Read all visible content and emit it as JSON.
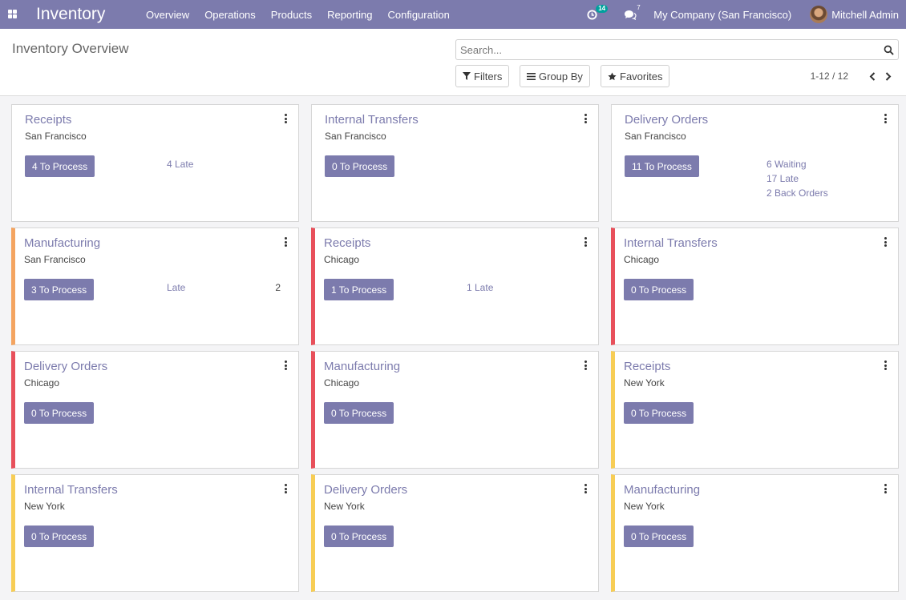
{
  "navbar": {
    "brand": "Inventory",
    "menu": [
      "Overview",
      "Operations",
      "Products",
      "Reporting",
      "Configuration"
    ],
    "activity_count": "14",
    "messages_count": "7",
    "company": "My Company (San Francisco)",
    "user": "Mitchell Admin",
    "colors": {
      "navbar": "#7c7bad",
      "badge": "#00a09d"
    }
  },
  "control_panel": {
    "title": "Inventory Overview",
    "search_placeholder": "Search...",
    "filters_label": "Filters",
    "groupby_label": "Group By",
    "favorites_label": "Favorites",
    "pager": "1-12 / 12"
  },
  "cards": [
    {
      "title": "Receipts",
      "subtitle": "San Francisco",
      "button": "4 To Process",
      "stats": [
        "4 Late"
      ],
      "bar": "none"
    },
    {
      "title": "Internal Transfers",
      "subtitle": "San Francisco",
      "button": "0 To Process",
      "stats": [],
      "bar": "none"
    },
    {
      "title": "Delivery Orders",
      "subtitle": "San Francisco",
      "button": "11 To Process",
      "stats": [
        "6 Waiting",
        "17 Late",
        "2 Back Orders"
      ],
      "bar": "none"
    },
    {
      "title": "Manufacturing",
      "subtitle": "San Francisco",
      "button": "3 To Process",
      "stats": [
        "Late"
      ],
      "count": "2",
      "bar": "orange"
    },
    {
      "title": "Receipts",
      "subtitle": "Chicago",
      "button": "1 To Process",
      "stats": [
        "1 Late"
      ],
      "bar": "red"
    },
    {
      "title": "Internal Transfers",
      "subtitle": "Chicago",
      "button": "0 To Process",
      "stats": [],
      "bar": "red"
    },
    {
      "title": "Delivery Orders",
      "subtitle": "Chicago",
      "button": "0 To Process",
      "stats": [],
      "bar": "red"
    },
    {
      "title": "Manufacturing",
      "subtitle": "Chicago",
      "button": "0 To Process",
      "stats": [],
      "bar": "red"
    },
    {
      "title": "Receipts",
      "subtitle": "New York",
      "button": "0 To Process",
      "stats": [],
      "bar": "yellow"
    },
    {
      "title": "Internal Transfers",
      "subtitle": "New York",
      "button": "0 To Process",
      "stats": [],
      "bar": "yellow"
    },
    {
      "title": "Delivery Orders",
      "subtitle": "New York",
      "button": "0 To Process",
      "stats": [],
      "bar": "yellow"
    },
    {
      "title": "Manufacturing",
      "subtitle": "New York",
      "button": "0 To Process",
      "stats": [],
      "bar": "yellow"
    }
  ],
  "colors": {
    "accent": "#7c7bad",
    "orange": "#f4a460",
    "red": "#e8505b",
    "yellow": "#f7cd55"
  }
}
